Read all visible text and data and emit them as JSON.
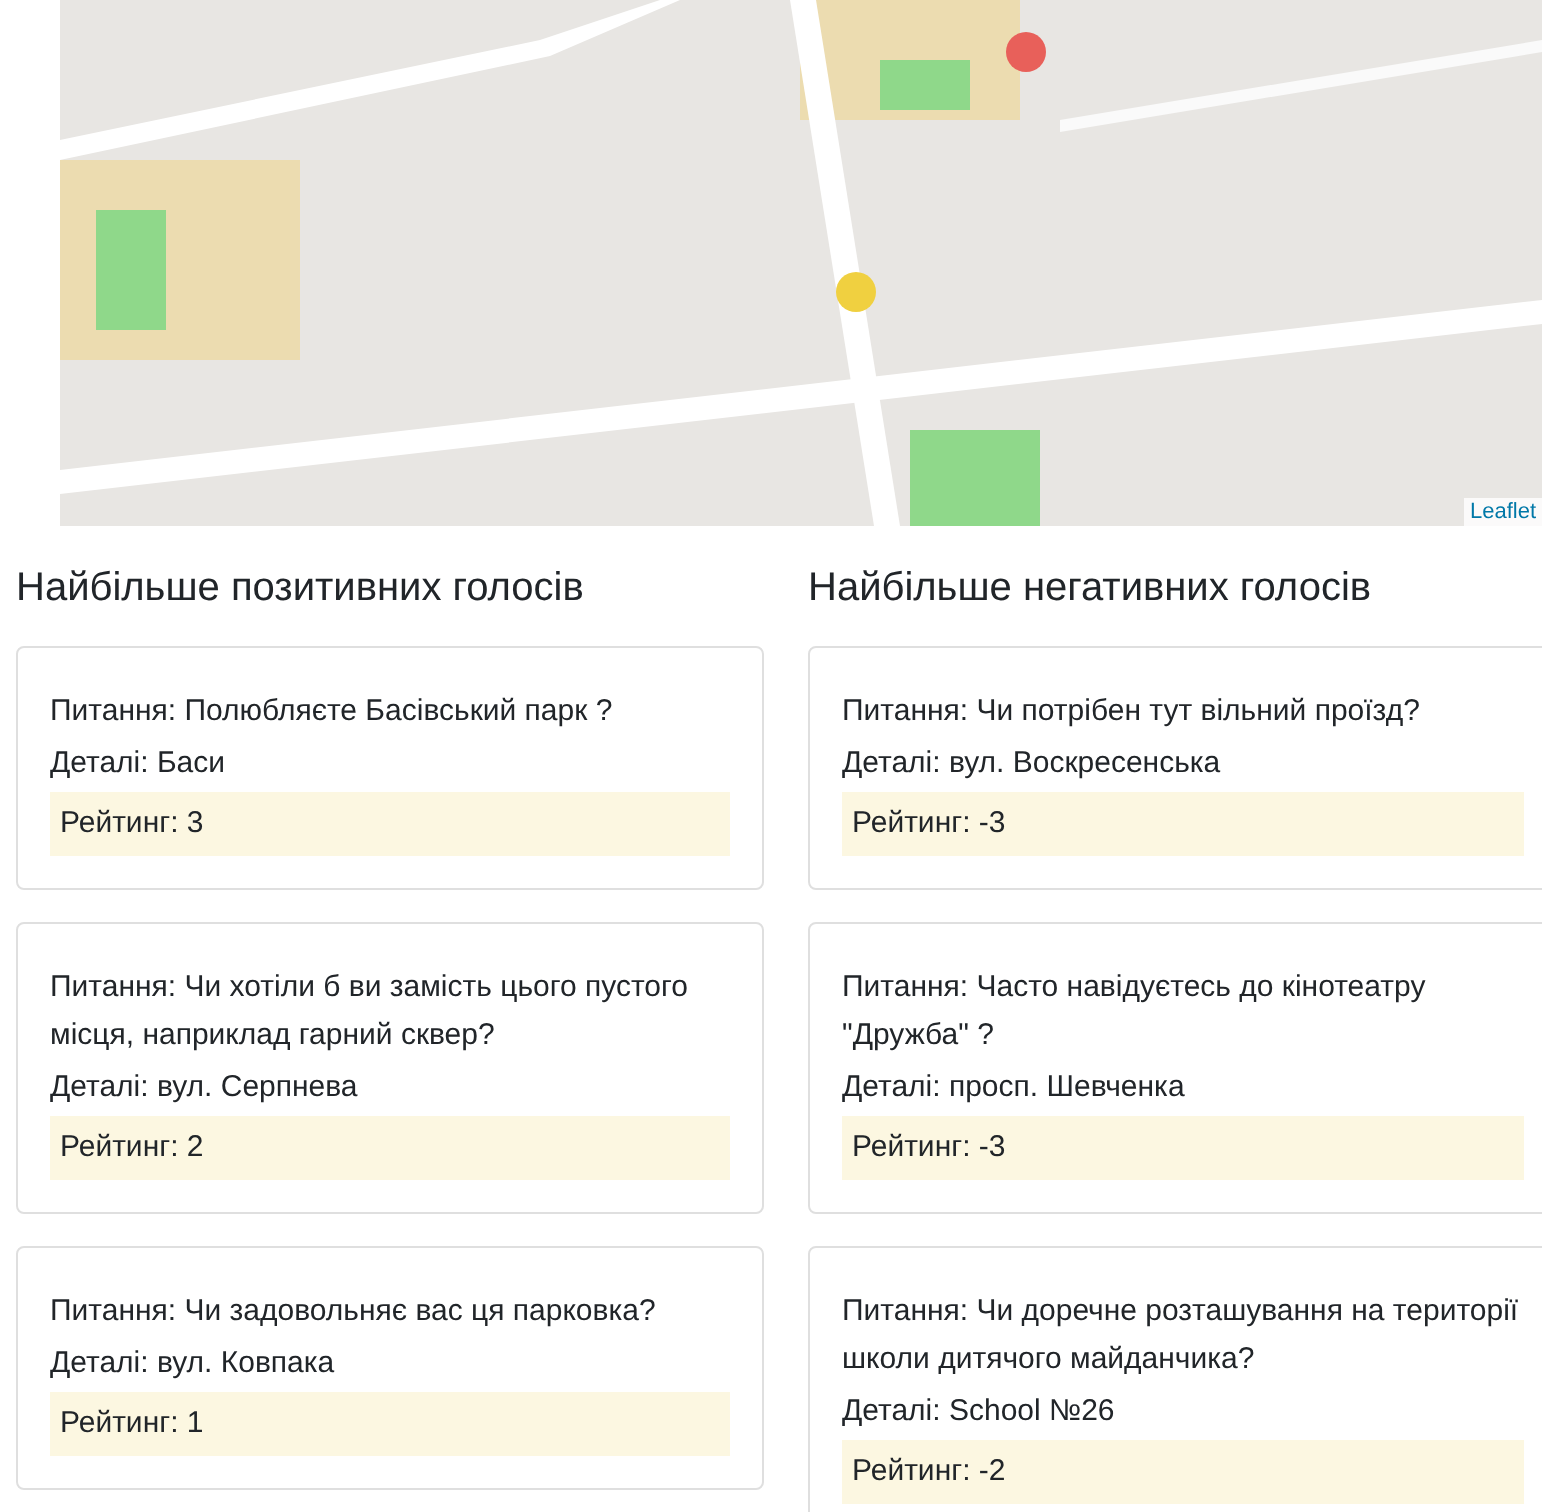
{
  "map": {
    "kind": "picture",
    "attribution": "Leaflet"
  },
  "columns": [
    {
      "title": "Найбільше позитивних голосів",
      "cards": [
        {
          "question": "Питання: Полюбляєте Басівський парк ?",
          "details": "Деталі: Баси",
          "rating": "Рейтинг: 3"
        },
        {
          "question": "Питання: Чи хотіли б ви замість цього пустого місця, наприклад гарний сквер?",
          "details": "Деталі: вул. Серпнева",
          "rating": "Рейтинг: 2"
        },
        {
          "question": "Питання: Чи задовольняє вас ця парковка?",
          "details": "Деталі: вул. Ковпака",
          "rating": "Рейтинг: 1"
        }
      ]
    },
    {
      "title": "Найбільше негативних голосів",
      "cards": [
        {
          "question": "Питання: Чи потрібен тут вільний проїзд?",
          "details": "Деталі: вул. Воскресенська",
          "rating": "Рейтинг: -3"
        },
        {
          "question": "Питання: Часто навідуєтесь до кінотеатру \"Дружба\" ?",
          "details": "Деталі: просп. Шевченка",
          "rating": "Рейтинг: -3"
        },
        {
          "question": "Питання: Чи доречне розташування на території школи дитячого майданчика?",
          "details": "Деталі: School №26",
          "rating": "Рейтинг: -2"
        }
      ]
    }
  ]
}
